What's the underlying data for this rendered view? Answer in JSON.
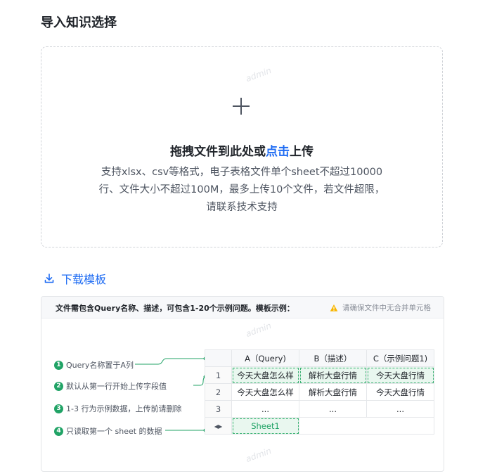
{
  "page": {
    "title": "导入知识选择"
  },
  "upload": {
    "main_prefix": "拖拽文件到此处或",
    "main_link": "点击",
    "main_suffix": "上传",
    "hint_line1": "支持xlsx、csv等格式，电子表格文件单个sheet不超过10000",
    "hint_line2": "行、文件大小不超过100M，最多上传10个文件，若文件超限，",
    "hint_line3": "请联系技术支持",
    "icon": "plus-icon"
  },
  "download": {
    "label": "下载模板",
    "icon": "download-icon"
  },
  "example": {
    "description": "文件需包含Query名称、描述，可包含1-20个示例问题。模板示例：",
    "warning": "请确保文件中无合并单元格",
    "steps": [
      {
        "num": "1",
        "text": "Query名称置于A列"
      },
      {
        "num": "2",
        "text": "默认从第一行开始上传字段值"
      },
      {
        "num": "3",
        "text": "1-3 行为示例数据，上传前请删除"
      },
      {
        "num": "4",
        "text": "只读取第一个 sheet 的数据"
      }
    ],
    "table": {
      "headers": [
        "A（Query)",
        "B（描述）",
        "C（示例问题1)"
      ],
      "rows": [
        {
          "num": "1",
          "cells": [
            "今天大盘怎么样",
            "解析大盘行情",
            "今天大盘行情"
          ]
        },
        {
          "num": "2",
          "cells": [
            "今天大盘怎么样",
            "解析大盘行情",
            "今天大盘行情"
          ]
        },
        {
          "num": "3",
          "cells": [
            "...",
            "...",
            "..."
          ]
        }
      ],
      "sheet_nav": "◂▸",
      "sheet_tab": "Sheet1"
    }
  },
  "watermark": "admin",
  "colors": {
    "accent": "#1f6cf3",
    "green": "#21a366",
    "warning": "#f7b500"
  }
}
